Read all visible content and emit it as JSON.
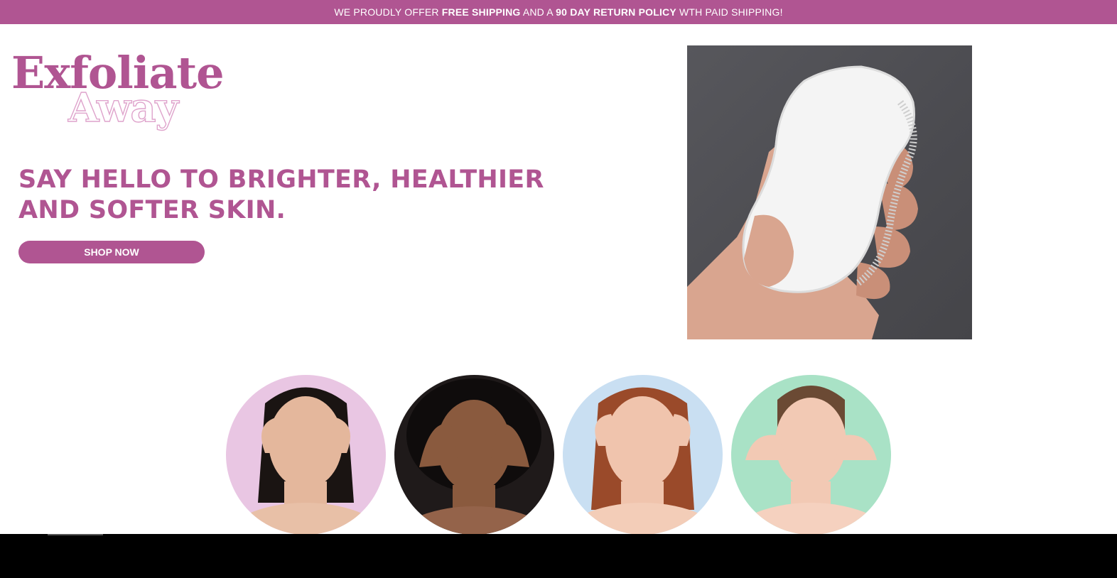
{
  "announcement": {
    "part1": "WE PROUDLY OFFER ",
    "bold1": "FREE SHIPPING",
    "part2": " AND A ",
    "bold2": "90 DAY RETURN POLICY",
    "part3": " WTH PAID SHIPPING!"
  },
  "logo": {
    "line1": "Exfoliate",
    "line2": "Away"
  },
  "hero": {
    "headline": "SAY HELLO TO BRIGHTER, HEALTHIER AND SOFTER SKIN.",
    "cta_label": "SHOP NOW"
  },
  "colors": {
    "brand": "#b05592",
    "logo_outline": "#dfa4cc"
  },
  "faces": [
    {
      "background": "#e9c6e3"
    },
    {
      "background": "#1f1a1a"
    },
    {
      "background": "#c9dff2"
    },
    {
      "background": "#a9e2c6"
    }
  ]
}
